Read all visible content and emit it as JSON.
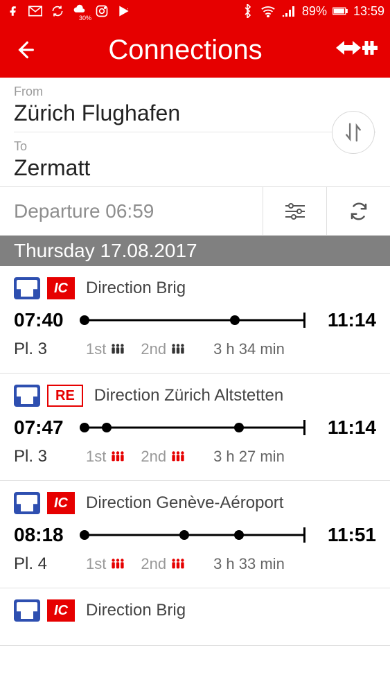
{
  "status": {
    "battery": "89%",
    "time": "13:59",
    "weather": "30%"
  },
  "header": {
    "title": "Connections"
  },
  "search": {
    "from_label": "From",
    "from_value": "Zürich Flughafen",
    "to_label": "To",
    "to_value": "Zermatt"
  },
  "departure": {
    "label": "Departure 06:59"
  },
  "date_header": "Thursday 17.08.2017",
  "connections": [
    {
      "badge": "IC",
      "badge_style": "ic",
      "direction": "Direction Brig",
      "dep": "07:40",
      "arr": "11:14",
      "platform": "Pl. 3",
      "first_label": "1st",
      "second_label": "2nd",
      "first_occ": "low",
      "second_occ": "low",
      "duration": "3 h 34 min",
      "stops": [
        0,
        68
      ]
    },
    {
      "badge": "RE",
      "badge_style": "re",
      "direction": "Direction Zürich Altstetten",
      "dep": "07:47",
      "arr": "11:14",
      "platform": "Pl. 3",
      "first_label": "1st",
      "second_label": "2nd",
      "first_occ": "high",
      "second_occ": "high",
      "duration": "3 h 27 min",
      "stops": [
        0,
        10,
        70
      ]
    },
    {
      "badge": "IC",
      "badge_style": "ic",
      "direction": "Direction Genève-Aéroport",
      "dep": "08:18",
      "arr": "11:51",
      "platform": "Pl. 4",
      "first_label": "1st",
      "second_label": "2nd",
      "first_occ": "high",
      "second_occ": "high",
      "duration": "3 h 33 min",
      "stops": [
        0,
        45,
        70
      ]
    },
    {
      "badge": "IC",
      "badge_style": "ic",
      "direction": "Direction Brig",
      "dep": "",
      "arr": "",
      "platform": "",
      "first_label": "",
      "second_label": "",
      "first_occ": "",
      "second_occ": "",
      "duration": "",
      "stops": []
    }
  ]
}
